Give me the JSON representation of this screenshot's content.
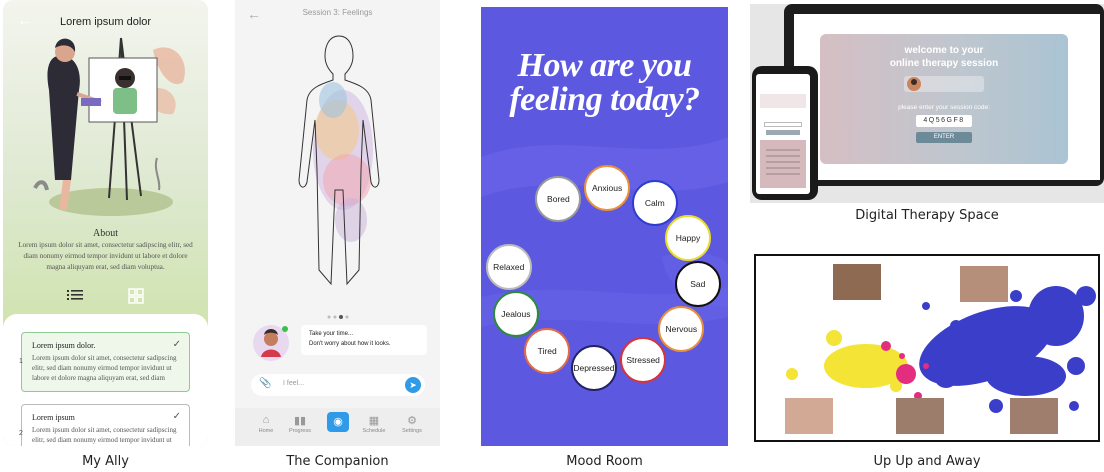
{
  "captions": {
    "ally": "My Ally",
    "companion": "The Companion",
    "mood": "Mood Room",
    "dts": "Digital Therapy Space",
    "uuaa": "Up Up and Away"
  },
  "ally": {
    "title": "Lorem ipsum dolor",
    "about_heading": "About",
    "about_body": "Lorem ipsum dolor sit amet, consectetur sadipscing elitr, sed diam nonumy eirmod tempor invidunt ut labore et dolore magna aliquyam erat, sed diam voluptua.",
    "cards": [
      {
        "number": "1",
        "title": "Lorem ipsum dolor.",
        "body": "Lorem ipsum dolor sit amet, consectetur sadipscing elitr, sed diam nonumy eirmod tempor invidunt ut labore et dolore magna aliquyam erat, sed diam"
      },
      {
        "number": "2",
        "title": "Lorem ipsum",
        "body": "Lorem ipsum dolor sit amet, consectetur sadipscing elitr, sed diam nonumy eirmod tempor invidunt ut"
      }
    ],
    "colors": {
      "accent": "#5fb26a",
      "bg_top": "#f3f5ee",
      "bg_bottom": "#c4de9b"
    }
  },
  "companion": {
    "title": "Session 3: Feelings",
    "chat_line_1": "Take your time...",
    "chat_line_2": "Don't worry about how it looks.",
    "input_placeholder": "I feel...",
    "nav": [
      {
        "label": "Home",
        "icon": "home-icon"
      },
      {
        "label": "Progress",
        "icon": "bar-chart-icon"
      },
      {
        "label": "",
        "icon": "camera-icon"
      },
      {
        "label": "Schedule",
        "icon": "calendar-icon"
      },
      {
        "label": "Settings",
        "icon": "gear-icon"
      }
    ]
  },
  "mood": {
    "title_line_1": "How are you",
    "title_line_2": "feeling today?",
    "feelings": [
      {
        "label": "Bored",
        "color": "#9a9a9a"
      },
      {
        "label": "Anxious",
        "color": "#e8903a"
      },
      {
        "label": "Calm",
        "color": "#2d3ccf"
      },
      {
        "label": "Happy",
        "color": "#e9dd2a"
      },
      {
        "label": "Sad",
        "color": "#111111"
      },
      {
        "label": "Nervous",
        "color": "#e8903a"
      },
      {
        "label": "Stressed",
        "color": "#d8323a"
      },
      {
        "label": "Depressed",
        "color": "#222266"
      },
      {
        "label": "Tired",
        "color": "#e06b4a"
      },
      {
        "label": "Jealous",
        "color": "#2e8a3a"
      },
      {
        "label": "Relaxed",
        "color": "#bbbbbb"
      }
    ],
    "bg_color": "#5c59e0"
  },
  "dts": {
    "welcome_line_1": "welcome to your",
    "welcome_line_2": "online therapy session",
    "prompt": "please enter your session code:",
    "code": "4Q56GF8",
    "enter_label": "ENTER"
  }
}
